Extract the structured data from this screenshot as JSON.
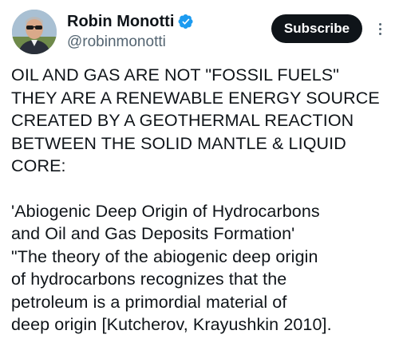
{
  "author": {
    "display_name": "Robin Monotti",
    "handle": "@robinmonotti",
    "verified": true,
    "verified_color": "#1d9bf0",
    "avatar_icon": "profile-photo"
  },
  "actions": {
    "subscribe_label": "Subscribe",
    "more_icon": "more-vertical-icon"
  },
  "post": {
    "paragraph1": [
      "OIL AND GAS ARE NOT \"FOSSIL FUELS\"",
      "THEY ARE A RENEWABLE ENERGY SOURCE",
      "CREATED BY A GEOTHERMAL REACTION",
      "BETWEEN THE SOLID MANTLE & LIQUID",
      "CORE:"
    ],
    "paragraph2": [
      "'Abiogenic Deep Origin of Hydrocarbons",
      "and Oil and Gas Deposits Formation'",
      "\"The theory of the abiogenic deep origin",
      "of hydrocarbons recognizes that the",
      "petroleum is a primordial material of",
      "deep origin [Kutcherov, Krayushkin 2010]."
    ]
  }
}
